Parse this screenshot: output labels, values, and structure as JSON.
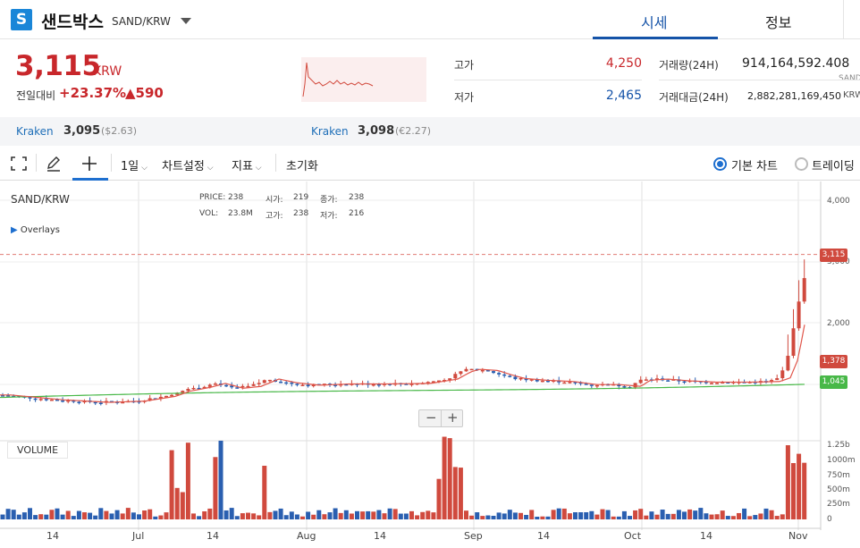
{
  "header": {
    "logo_letter": "S",
    "coin_name": "샌드박스",
    "pair": "SAND/KRW",
    "tabs": [
      {
        "label": "시세",
        "active": true
      },
      {
        "label": "정보",
        "active": false
      }
    ]
  },
  "ticker": {
    "price": "3,115",
    "unit": "KRW",
    "change_label": "전일대비",
    "change_pct": "+23.37%",
    "change_abs": "▲590",
    "high_label": "고가",
    "high": "4,250",
    "low_label": "저가",
    "low": "2,465",
    "volume_label": "거래량(24H)",
    "volume": "914,164,592.408",
    "volume_unit": "SAND",
    "value_label": "거래대금(24H)",
    "value": "2,882,281,169,450",
    "value_unit": "KRW"
  },
  "exchanges": [
    {
      "name": "Kraken",
      "price": "3,095",
      "sub": "($2.63)"
    },
    {
      "name": "Kraken",
      "price": "3,098",
      "sub": "(€2.27)"
    }
  ],
  "toolbar": {
    "interval": "1일",
    "chart_settings": "차트설정",
    "indicators": "지표",
    "reset": "초기화",
    "basic_chart": "기본 차트",
    "trading_view": "트레이딩"
  },
  "legend": {
    "symbol": "SAND/KRW",
    "overlays": "Overlays",
    "price_label": "PRICE:",
    "price": "238",
    "open_label": "시가:",
    "open": "219",
    "close_label": "종가:",
    "close": "238",
    "vol_label": "VOL:",
    "vol": "23.8M",
    "high_label": "고가:",
    "high": "238",
    "low_label": "저가:",
    "low": "216"
  },
  "colors": {
    "up": "#d04a3e",
    "down": "#2a5fb0",
    "ma_short": "#e0554a",
    "ma_long": "#48b848",
    "accent": "#1553a8"
  },
  "chart_data": {
    "type": "candlestick",
    "x_ticks": [
      "14",
      "Jul",
      "14",
      "Aug",
      "14",
      "Sep",
      "14",
      "Oct",
      "14",
      "Nov"
    ],
    "y_ticks": [
      "4,000",
      "3,000",
      "2,000"
    ],
    "volume_ticks": [
      "1.25b",
      "1000m",
      "750m",
      "500m",
      "250m",
      "0"
    ],
    "price_tags": [
      {
        "label": "3,115",
        "value": 3115,
        "color": "#d04a3e"
      },
      {
        "label": "1,378",
        "value": 1378,
        "color": "#d04a3e"
      },
      {
        "label": "1,045",
        "value": 1045,
        "color": "#48b848"
      }
    ],
    "volume_label": "VOLUME",
    "ylim": [
      0,
      4300
    ]
  }
}
